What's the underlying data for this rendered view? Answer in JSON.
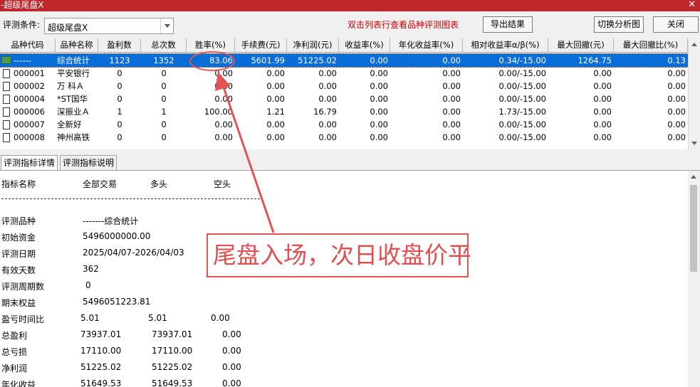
{
  "window": {
    "title": "-超级尾盘X",
    "close_glyph": "✕"
  },
  "toolbar": {
    "condition_label": "评测条件:",
    "condition_value": "超级尾盘X",
    "hint": "双击列表行查看品种评测图表",
    "export_label": "导出结果",
    "switch_label": "切换分析图",
    "close_label": "关闭"
  },
  "table": {
    "headers": [
      "品种代码",
      "品种名称",
      "盈利数",
      "总次数",
      "胜率(%)",
      "手续费(元)",
      "净利润(元)",
      "收益率(%)",
      "年化收益率(%)",
      "相对收益率α/β(%)",
      "最大回撤(元)",
      "最大回撤比(%)"
    ],
    "rows": [
      [
        "------",
        "综合统计",
        "1123",
        "1352",
        "83.06",
        "5601.99",
        "51225.02",
        "0.00",
        "0.00",
        "0.34/-15.00",
        "1264.75",
        "0.13"
      ],
      [
        "000001",
        "平安银行",
        "0",
        "0",
        "0.00",
        "0.00",
        "0.00",
        "0.00",
        "0.00",
        "0.00/-15.00",
        "0.00",
        "0.00"
      ],
      [
        "000002",
        "万 科Ａ",
        "0",
        "0",
        "0.00",
        "0.00",
        "0.00",
        "0.00",
        "0.00",
        "0.00/-15.00",
        "0.00",
        "0.00"
      ],
      [
        "000004",
        "*ST国华",
        "0",
        "0",
        "0.00",
        "0.00",
        "0.00",
        "0.00",
        "0.00",
        "0.00/-15.00",
        "0.00",
        "0.00"
      ],
      [
        "000006",
        "深振业Ａ",
        "1",
        "1",
        "100.00",
        "1.21",
        "16.79",
        "0.00",
        "0.00",
        "1.73/-15.00",
        "0.00",
        "0.00"
      ],
      [
        "000007",
        "全新好",
        "0",
        "0",
        "0.00",
        "0.00",
        "0.00",
        "0.00",
        "0.00",
        "0.00/-15.00",
        "0.00",
        "0.00"
      ],
      [
        "000008",
        "神州高铁",
        "0",
        "0",
        "0.00",
        "0.00",
        "0.00",
        "0.00",
        "0.00",
        "0.00/-15.00",
        "0.00",
        "0.00"
      ]
    ]
  },
  "tabs": [
    "评测指标详情",
    "评测指标说明"
  ],
  "detail": {
    "headers": [
      "指标名称",
      "全部交易",
      "多头",
      "空头"
    ],
    "rows": [
      {
        "name": "评测品种",
        "all": "-------综合统计",
        "long": "",
        "short": ""
      },
      {
        "name": "初始资金",
        "all": "5496000000.00",
        "long": "",
        "short": ""
      },
      {
        "name": "评测日期",
        "all": "2025/04/07-2026/04/03",
        "long": "",
        "short": ""
      },
      {
        "name": "有效天数",
        "all": "362",
        "long": "",
        "short": ""
      },
      {
        "name": "评测周期数",
        "all": "0",
        "long": "",
        "short": ""
      },
      {
        "name": "期末权益",
        "all": "5496051223.81",
        "long": "",
        "short": ""
      },
      {
        "name": "盈亏时间比",
        "all": "5.01",
        "long": "5.01",
        "short": "0.00"
      },
      {
        "name": "总盈利",
        "all": "73937.01",
        "long": "73937.01",
        "short": "0.00"
      },
      {
        "name": "总亏损",
        "all": "17110.00",
        "long": "17110.00",
        "short": "0.00"
      },
      {
        "name": "净利润",
        "all": "51225.02",
        "long": "51225.02",
        "short": "0.00"
      },
      {
        "name": "年化收益",
        "all": "51649.53",
        "long": "51649.53",
        "short": "0.00"
      }
    ]
  },
  "annotation": {
    "callout_text": "尾盘入场，次日收盘价平",
    "color": "#e55454"
  },
  "colors": {
    "titlebar": "#c0272d",
    "selection": "#0a6cd6",
    "hint": "#cc0000"
  }
}
